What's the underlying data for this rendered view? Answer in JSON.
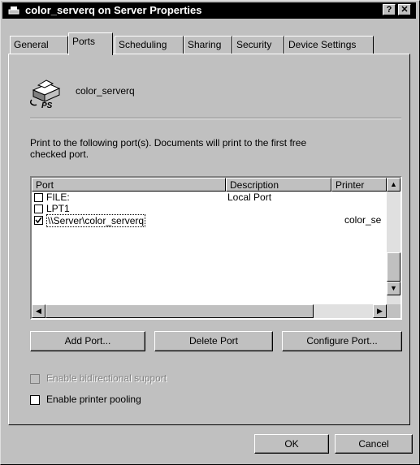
{
  "window": {
    "title": "color_serverq on Server Properties",
    "help_label": "?",
    "close_label": "✕"
  },
  "tabs": [
    {
      "label": "General"
    },
    {
      "label": "Ports",
      "active": true
    },
    {
      "label": "Scheduling"
    },
    {
      "label": "Sharing"
    },
    {
      "label": "Security"
    },
    {
      "label": "Device Settings"
    }
  ],
  "printer": {
    "name": "color_serverq",
    "icon_badge": "PS"
  },
  "instructions": {
    "line1": "Print to the following port(s).  Documents will print to the first free",
    "line2": "checked port."
  },
  "port_list": {
    "columns": {
      "port": "Port",
      "description": "Description",
      "printer": "Printer"
    },
    "rows": [
      {
        "port": "FILE:",
        "description": "Local Port",
        "printer": "",
        "checked": false
      },
      {
        "port": "LPT1",
        "description": "",
        "printer": "",
        "checked": false
      },
      {
        "port": "\\\\Server\\color_serverq",
        "description": "",
        "printer": "color_se",
        "checked": true
      }
    ]
  },
  "buttons": {
    "add_port": "Add Port...",
    "delete_port": "Delete Port",
    "configure_port": "Configure Port...",
    "ok": "OK",
    "cancel": "Cancel"
  },
  "options": {
    "bidirectional": {
      "label": "Enable bidirectional support",
      "checked": false,
      "enabled": false
    },
    "pooling": {
      "label": "Enable printer pooling",
      "checked": false,
      "enabled": true
    }
  }
}
